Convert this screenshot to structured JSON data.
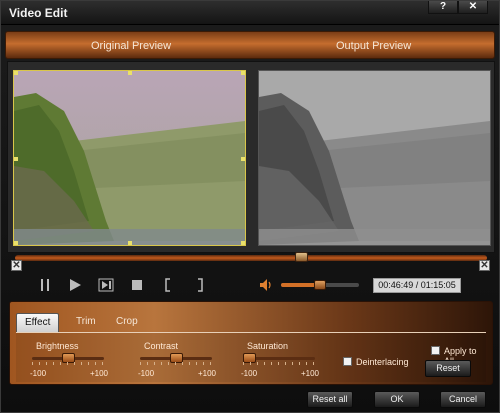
{
  "window": {
    "title": "Video Edit"
  },
  "titlebar": {
    "help_glyph": "?",
    "close_glyph": "✕"
  },
  "preview": {
    "original_label": "Original Preview",
    "output_label": "Output Preview"
  },
  "seek": {
    "position_fraction": 0.61,
    "start_glyph": "✕",
    "end_glyph": "✕"
  },
  "playback": {
    "volume_fraction": 0.5,
    "time_display": "00:46:49 / 01:15:05"
  },
  "tabs": [
    {
      "label": "Effect",
      "active": true
    },
    {
      "label": "Trim",
      "active": false
    },
    {
      "label": "Crop",
      "active": false
    }
  ],
  "effect": {
    "brightness": {
      "label": "Brightness",
      "min_label": "-100",
      "max_label": "+100",
      "value_fraction": 0.5
    },
    "contrast": {
      "label": "Contrast",
      "min_label": "-100",
      "max_label": "+100",
      "value_fraction": 0.5
    },
    "saturation": {
      "label": "Saturation",
      "min_label": "-100",
      "max_label": "+100",
      "value_fraction": 0.0
    },
    "deinterlacing_label": "Deinterlacing",
    "deinterlacing_checked": false,
    "apply_to_all_label": "Apply to All",
    "apply_to_all_checked": false,
    "reset_label": "Reset"
  },
  "footer": {
    "reset_all_label": "Reset all",
    "ok_label": "OK",
    "cancel_label": "Cancel"
  },
  "colors": {
    "accent": "#c56d2e",
    "crop_frame": "#d9c64a"
  },
  "icons": [
    "pause-icon",
    "play-icon",
    "next-frame-icon",
    "stop-icon",
    "mark-in-icon",
    "mark-out-icon",
    "volume-icon"
  ]
}
